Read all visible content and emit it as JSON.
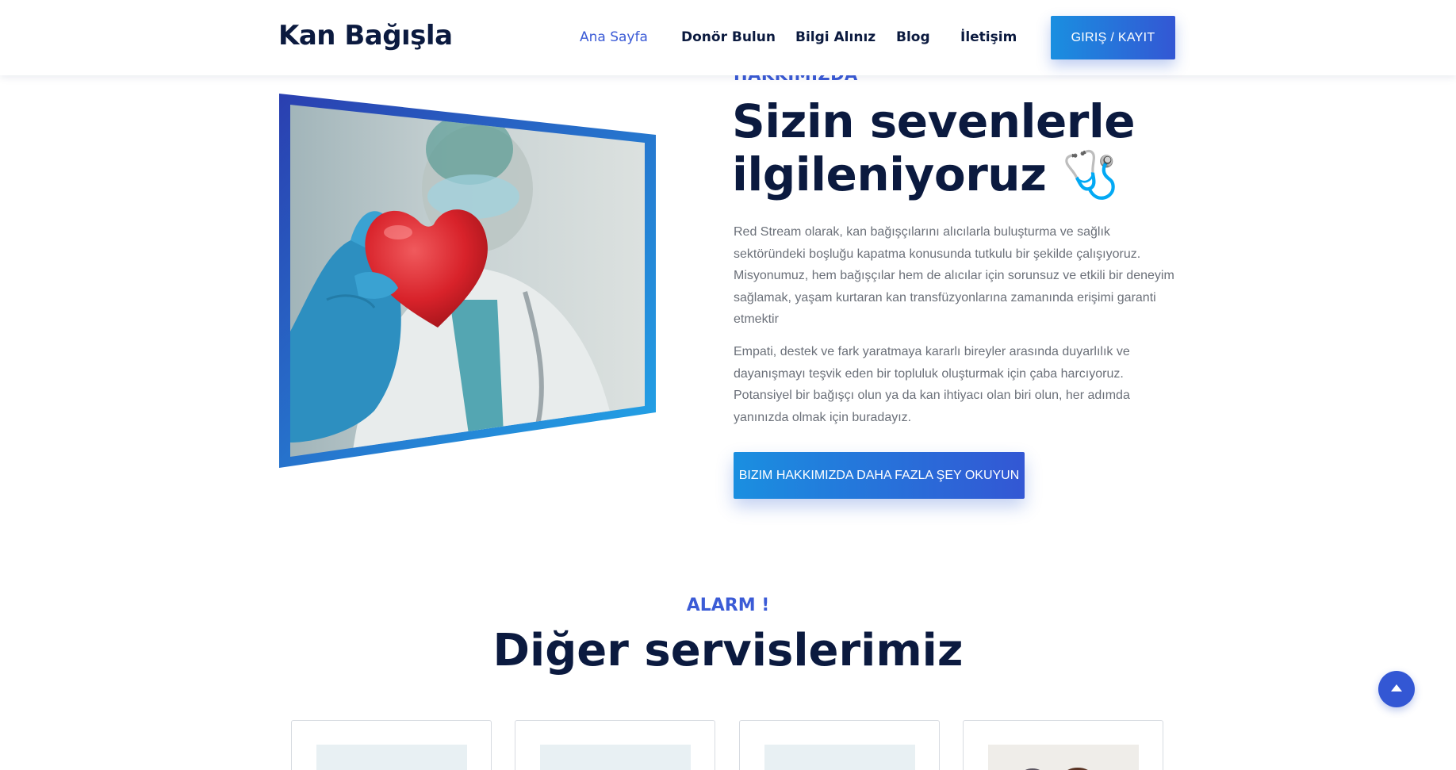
{
  "header": {
    "logo": "Kan Bağışla",
    "nav": [
      {
        "label": "Ana Sayfa",
        "active": true
      },
      {
        "label": "Donör Bulun",
        "active": false
      },
      {
        "label": "Bilgi Alınız",
        "active": false
      },
      {
        "label": "Blog",
        "active": false
      },
      {
        "label": "İletişim",
        "active": false
      }
    ],
    "login_label": "GIRIŞ / KAYIT"
  },
  "about": {
    "eyebrow": "HAKKIMIZDA",
    "title_line1": "Sizin sevenlerle",
    "title_line2": "ilgileniyoruz 🩺",
    "paragraph1": "Red Stream olarak, kan bağışçılarını alıcılarla buluşturma ve sağlık sektöründeki boşluğu kapatma konusunda tutkulu bir şekilde çalışıyoruz. Misyonumuz, hem bağışçılar hem de alıcılar için sorunsuz ve etkili bir deneyim sağlamak, yaşam kurtaran kan transfüzyonlarına zamanında erişimi garanti etmektir",
    "paragraph2": "Empati, destek ve fark yaratmaya kararlı bireyler arasında duyarlılık ve dayanışmayı teşvik eden bir topluluk oluşturmak için çaba harcıyoruz. Potansiyel bir bağışçı olun ya da kan ihtiyacı olan biri olun, her adımda yanınızda olmak için buradayız.",
    "button_label": "BIZIM HAKKIMIZDA DAHA FAZLA ŞEY OKUYUN"
  },
  "services": {
    "eyebrow": "ALARM !",
    "title": "Diğer servislerimiz"
  },
  "colors": {
    "accent": "#3b5bd6",
    "heading": "#0b1a3f",
    "body_text": "#6b7079",
    "button_gradient_start": "#1a8fe0",
    "button_gradient_end": "#3357d4",
    "heart_red": "#e0262b",
    "glove_blue": "#2a8fc0"
  },
  "icons": {
    "scroll_top": "arrow-up-icon"
  }
}
